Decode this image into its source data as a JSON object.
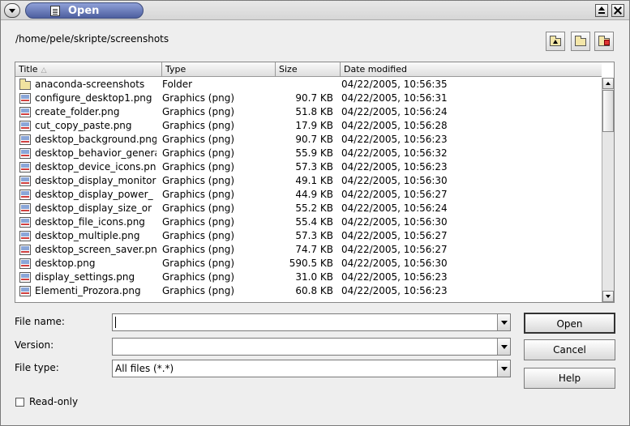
{
  "window": {
    "title": "Open"
  },
  "path": "/home/pele/skripte/screenshots",
  "columns": [
    "Title",
    "Type",
    "Size",
    "Date modified"
  ],
  "files": [
    {
      "name": "anaconda-screenshots",
      "type": "Folder",
      "size": "",
      "date": "04/22/2005, 10:56:35",
      "icon": "folder-icon"
    },
    {
      "name": "configure_desktop1.png",
      "type": "Graphics (png)",
      "size": "90.7 KB",
      "date": "04/22/2005, 10:56:31",
      "icon": "image-file-icon"
    },
    {
      "name": "create_folder.png",
      "type": "Graphics (png)",
      "size": "51.8 KB",
      "date": "04/22/2005, 10:56:24",
      "icon": "image-file-icon"
    },
    {
      "name": "cut_copy_paste.png",
      "type": "Graphics (png)",
      "size": "17.9 KB",
      "date": "04/22/2005, 10:56:28",
      "icon": "image-file-icon"
    },
    {
      "name": "desktop_background.png",
      "type": "Graphics (png)",
      "size": "90.7 KB",
      "date": "04/22/2005, 10:56:23",
      "icon": "image-file-icon"
    },
    {
      "name": "desktop_behavior_general",
      "type": "Graphics (png)",
      "size": "55.9 KB",
      "date": "04/22/2005, 10:56:32",
      "icon": "image-file-icon"
    },
    {
      "name": "desktop_device_icons.png",
      "type": "Graphics (png)",
      "size": "57.3 KB",
      "date": "04/22/2005, 10:56:23",
      "icon": "image-file-icon"
    },
    {
      "name": "desktop_display_monitor",
      "type": "Graphics (png)",
      "size": "49.1 KB",
      "date": "04/22/2005, 10:56:30",
      "icon": "image-file-icon"
    },
    {
      "name": "desktop_display_power_",
      "type": "Graphics (png)",
      "size": "44.9 KB",
      "date": "04/22/2005, 10:56:27",
      "icon": "image-file-icon"
    },
    {
      "name": "desktop_display_size_or",
      "type": "Graphics (png)",
      "size": "55.2 KB",
      "date": "04/22/2005, 10:56:24",
      "icon": "image-file-icon"
    },
    {
      "name": "desktop_file_icons.png",
      "type": "Graphics (png)",
      "size": "55.4 KB",
      "date": "04/22/2005, 10:56:30",
      "icon": "image-file-icon"
    },
    {
      "name": "desktop_multiple.png",
      "type": "Graphics (png)",
      "size": "57.3 KB",
      "date": "04/22/2005, 10:56:27",
      "icon": "image-file-icon"
    },
    {
      "name": "desktop_screen_saver.png",
      "type": "Graphics (png)",
      "size": "74.7 KB",
      "date": "04/22/2005, 10:56:27",
      "icon": "image-file-icon"
    },
    {
      "name": "desktop.png",
      "type": "Graphics (png)",
      "size": "590.5 KB",
      "date": "04/22/2005, 10:56:30",
      "icon": "image-file-icon"
    },
    {
      "name": "display_settings.png",
      "type": "Graphics (png)",
      "size": "31.0 KB",
      "date": "04/22/2005, 10:56:23",
      "icon": "image-file-icon"
    },
    {
      "name": "Elementi_Prozora.png",
      "type": "Graphics (png)",
      "size": "60.8 KB",
      "date": "04/22/2005, 10:56:23",
      "icon": "image-file-icon"
    }
  ],
  "form": {
    "file_name_label": "File name:",
    "file_name_value": "",
    "version_label": "Version:",
    "version_value": "",
    "file_type_label": "File type:",
    "file_type_value": "All files (*.*)",
    "readonly_label": "Read-only"
  },
  "buttons": {
    "open": "Open",
    "cancel": "Cancel",
    "help": "Help"
  }
}
